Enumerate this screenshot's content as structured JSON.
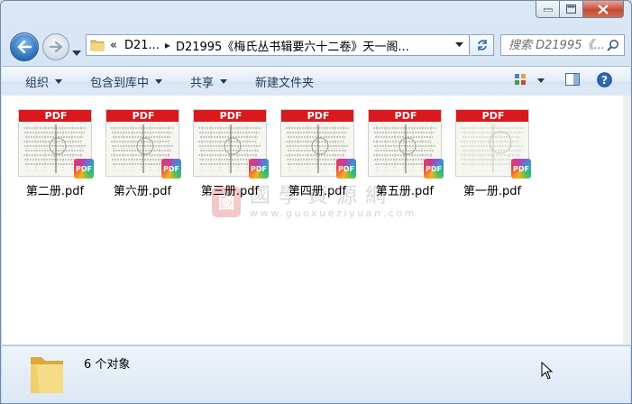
{
  "window": {
    "buttons": [
      "minimize",
      "maximize",
      "close"
    ]
  },
  "nav": {
    "back_icon": "back-arrow-icon",
    "forward_icon": "forward-arrow-icon",
    "breadcrumb_overflow": "«",
    "breadcrumb": [
      "D21...",
      "D21995《梅氏丛书辑要六十二卷》天一阁..."
    ],
    "search_placeholder": "搜索 D21995《..."
  },
  "toolbar": {
    "organize": "组织",
    "include_in_library": "包含到库中",
    "share": "共享",
    "new_folder": "新建文件夹"
  },
  "files": [
    {
      "name": "第二册.pdf",
      "banner": "PDF",
      "badge": "PDF"
    },
    {
      "name": "第六册.pdf",
      "banner": "PDF",
      "badge": "PDF"
    },
    {
      "name": "第三册.pdf",
      "banner": "PDF",
      "badge": "PDF"
    },
    {
      "name": "第四册.pdf",
      "banner": "PDF",
      "badge": "PDF"
    },
    {
      "name": "第五册.pdf",
      "banner": "PDF",
      "badge": "PDF"
    },
    {
      "name": "第一册.pdf",
      "banner": "PDF",
      "badge": "PDF"
    }
  ],
  "watermark": {
    "text": "國學資源網",
    "url": "www.guoxueziyuan.com",
    "seal": "國"
  },
  "status": {
    "count_text": "6 个对象"
  },
  "colors": {
    "pdf_banner": "#d9191c",
    "toolbar_text": "#1e395b",
    "close_button": "#c54b35"
  }
}
